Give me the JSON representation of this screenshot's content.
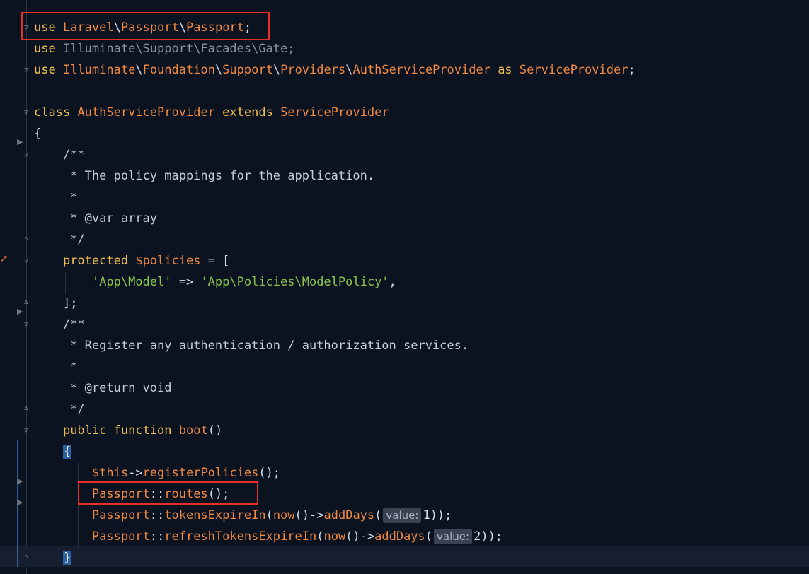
{
  "code": {
    "line1": {
      "use": "use",
      "laravel": "Laravel",
      "passport1": "Passport",
      "passport2": "Passport",
      "semi": ";"
    },
    "line2": {
      "use": "use",
      "path": "Illuminate\\Support\\Facades\\Gate",
      "semi": ";"
    },
    "line3": {
      "use": "use",
      "illuminate": "Illuminate",
      "foundation": "Foundation",
      "support": "Support",
      "providers": "Providers",
      "authsp": "AuthServiceProvider",
      "as": "as",
      "sp": "ServiceProvider",
      "semi": ";"
    },
    "line5": {
      "class": "class",
      "name": "AuthServiceProvider",
      "extends": "extends",
      "parent": "ServiceProvider"
    },
    "line6": {
      "brace": "{"
    },
    "line7": {
      "text": "/**"
    },
    "line8": {
      "text": " * The policy mappings for the application."
    },
    "line9": {
      "text": " *"
    },
    "line10": {
      "text": " * @var array"
    },
    "line11": {
      "text": " */"
    },
    "line12": {
      "protected": "protected",
      "var": "$policies",
      "rest": " = ["
    },
    "line13": {
      "key": "'App\\Model'",
      "arrow": " => ",
      "value": "'App\\Policies\\ModelPolicy'",
      "comma": ","
    },
    "line14": {
      "text": "];"
    },
    "line15": {
      "text": "/**"
    },
    "line16": {
      "text": " * Register any authentication / authorization services."
    },
    "line17": {
      "text": " *"
    },
    "line18": {
      "text": " * @return void"
    },
    "line19": {
      "text": " */"
    },
    "line20": {
      "public": "public",
      "function": "function",
      "name": "boot",
      "parens": "()"
    },
    "line21": {
      "brace": "{"
    },
    "line22": {
      "this": "$this",
      "arrow": "->",
      "method": "registerPolicies",
      "rest": "();"
    },
    "line23": {
      "cls": "Passport",
      "sep": "::",
      "method": "routes",
      "rest": "();"
    },
    "line24": {
      "cls": "Passport",
      "sep": "::",
      "method": "tokensExpireIn",
      "open": "(",
      "now": "now",
      "nowparens": "()",
      "arrow": "->",
      "add": "addDays",
      "open2": "(",
      "hint": "value:",
      "num": "1",
      "close": "));"
    },
    "line25": {
      "cls": "Passport",
      "sep": "::",
      "method": "refreshTokensExpireIn",
      "open": "(",
      "now": "now",
      "nowparens": "()",
      "arrow": "->",
      "add": "addDays",
      "open2": "(",
      "hint": "value:",
      "num": "2",
      "close": "));"
    },
    "line26": {
      "brace": "}"
    }
  },
  "icons": {
    "fold": "fold-icon",
    "breakpoint": "bookmark-arrow-icon",
    "override": "override-marker-icon"
  },
  "colors": {
    "background": "#0b1220",
    "keyword": "#f0c14b",
    "class": "#f08a3e",
    "string": "#8bc34a",
    "highlight_box": "#e5302a"
  }
}
